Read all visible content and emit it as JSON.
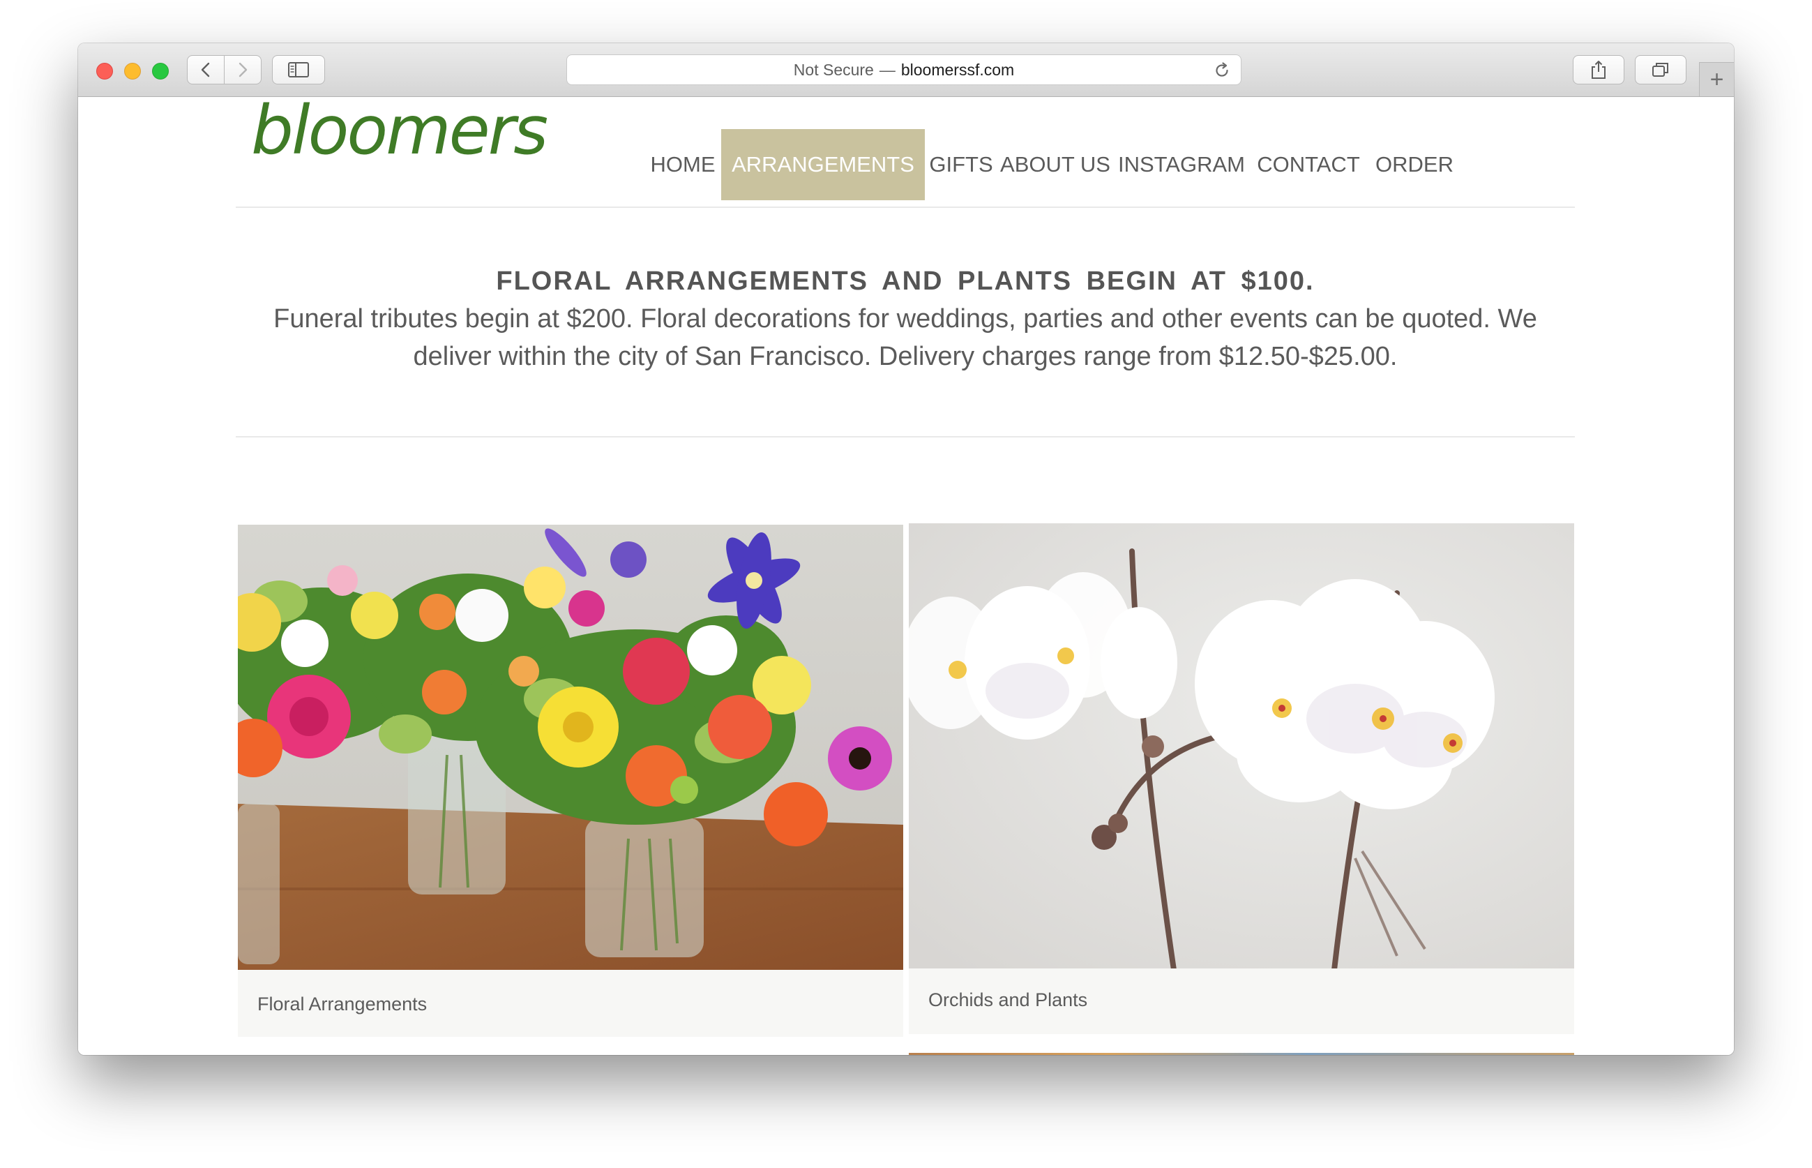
{
  "browser": {
    "security_label": "Not Secure",
    "separator": "—",
    "host": "bloomerssf.com",
    "icons": {
      "back": "chevron-left-icon",
      "forward": "chevron-right-icon",
      "sidebar": "sidebar-icon",
      "reload": "reload-icon",
      "share": "share-icon",
      "tabs": "tabs-overview-icon",
      "new_tab": "plus-icon"
    },
    "new_tab_glyph": "+"
  },
  "site": {
    "logo_text": "bloomers",
    "brand_color": "#3f7b26",
    "accent_color": "#c9c29e",
    "nav": [
      {
        "label": "HOME",
        "active": false
      },
      {
        "label": "ARRANGEMENTS",
        "active": true
      },
      {
        "label": "GIFTS",
        "active": false
      },
      {
        "label": "ABOUT US",
        "active": false
      },
      {
        "label": "INSTAGRAM",
        "active": false
      },
      {
        "label": "CONTACT",
        "active": false
      },
      {
        "label": "ORDER",
        "active": false
      }
    ]
  },
  "intro": {
    "heading": "FLORAL ARRANGEMENTS AND PLANTS BEGIN AT $100.",
    "body": "Funeral tributes begin at $200. Floral decorations for weddings, parties and other events can be quoted. We deliver within the city of San Francisco. Delivery charges range from $12.50-$25.00."
  },
  "gallery": [
    {
      "caption": "Floral Arrangements",
      "image": "floral-arrangements-photo"
    },
    {
      "caption": "Orchids and Plants",
      "image": "orchids-photo"
    }
  ]
}
